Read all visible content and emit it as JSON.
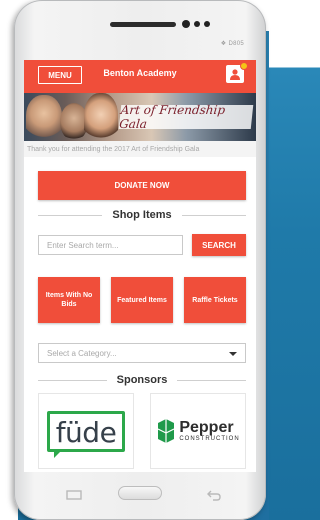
{
  "device": {
    "brand_mark": "❖ D805"
  },
  "topbar": {
    "menu_label": "MENU",
    "title": "Benton Academy"
  },
  "banner": {
    "title": "Art of Friendship Gala",
    "thanks_text": "Thank you for attending the 2017 Art of Friendship Gala"
  },
  "donate": {
    "label": "DONATE NOW"
  },
  "shop": {
    "heading": "Shop Items",
    "search_placeholder": "Enter Search term...",
    "search_label": "SEARCH",
    "tiles": [
      {
        "label": "Items With No Bids"
      },
      {
        "label": "Featured Items"
      },
      {
        "label": "Raffle Tickets"
      }
    ],
    "category_placeholder": "Select a Category..."
  },
  "sponsors": {
    "heading": "Sponsors",
    "items": [
      {
        "name": "füde"
      },
      {
        "name": "Pepper",
        "sub": "CONSTRUCTION"
      }
    ]
  },
  "colors": {
    "accent": "#f04e3a",
    "badge": "#f5c417",
    "fude_green": "#2ca84a",
    "pepper_green": "#1f9a4a"
  }
}
